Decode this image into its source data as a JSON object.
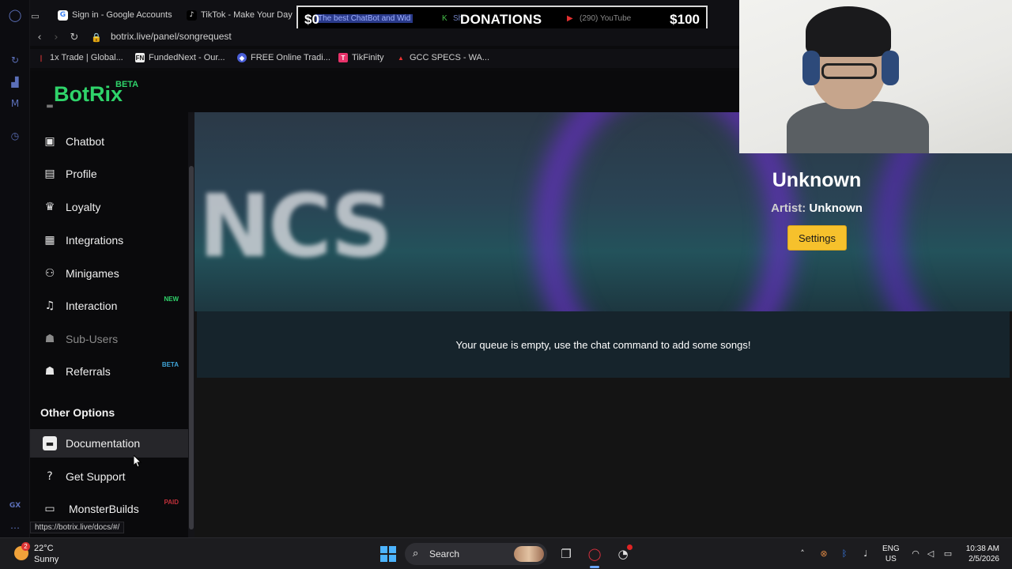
{
  "browser": {
    "tabs": [
      {
        "label": "Sign in - Google Accounts",
        "icon": "google-icon"
      },
      {
        "label": "TikTok - Make Your Day",
        "icon": "tiktok-icon"
      },
      {
        "label": "The best ChatBot and Wid",
        "icon": "botrix-icon"
      },
      {
        "label": "Sh",
        "icon": "kick-icon"
      },
      {
        "label": "(290) YouTube",
        "icon": "youtube-icon"
      }
    ],
    "url": "botrix.live/panel/songrequest",
    "bookmarks": [
      {
        "label": "1x Trade | Global...",
        "icon": "1x-icon"
      },
      {
        "label": "FundedNext - Our...",
        "icon": "fundednext-icon"
      },
      {
        "label": "FREE Online Tradi...",
        "icon": "trading-icon"
      },
      {
        "label": "TikFinity",
        "icon": "tikfinity-icon"
      },
      {
        "label": "GCC SPECS - WA...",
        "icon": "gcc-icon"
      }
    ],
    "link_hint": "https://botrix.live/docs/#/"
  },
  "donation_overlay": {
    "left_amount": "$0",
    "title": "DONATIONS",
    "right_amount": "$100"
  },
  "site": {
    "logo": "BotRix",
    "logo_badge": "BETA"
  },
  "sidebar": {
    "items": [
      {
        "label": "Chatbot",
        "icon": "robot-icon",
        "badge": ""
      },
      {
        "label": "Profile",
        "icon": "id-card-icon",
        "badge": ""
      },
      {
        "label": "Loyalty",
        "icon": "trophy-icon",
        "badge": ""
      },
      {
        "label": "Integrations",
        "icon": "integrations-icon",
        "badge": ""
      },
      {
        "label": "Minigames",
        "icon": "gamepad-icon",
        "badge": ""
      },
      {
        "label": "Interaction",
        "icon": "music-note-icon",
        "badge": "NEW"
      },
      {
        "label": "Sub-Users",
        "icon": "users-icon",
        "badge": ""
      },
      {
        "label": "Referrals",
        "icon": "user-group-icon",
        "badge": "BETA"
      }
    ],
    "other_title": "Other Options",
    "other_items": [
      {
        "label": "Documentation",
        "icon": "scroll-icon",
        "badge": ""
      },
      {
        "label": "Get Support",
        "icon": "question-circle-icon",
        "badge": ""
      },
      {
        "label": "MonsterBuilds",
        "icon": "laptop-icon",
        "badge": "PAID"
      }
    ]
  },
  "player": {
    "song_title": "Unknown",
    "artist_label": "Artist:",
    "artist_value": "Unknown",
    "settings_label": "Settings",
    "banner_text": "NCS",
    "queue_message": "Your queue is empty, use the chat command to add some songs!"
  },
  "taskbar": {
    "weather_temp": "22°C",
    "weather_desc": "Sunny",
    "weather_badge": "2",
    "search_label": "Search",
    "lang_top": "ENG",
    "lang_bottom": "US",
    "time": "10:38 AM",
    "date": "2/5/2026"
  },
  "colors": {
    "brand_green": "#2fd36a",
    "settings_yellow": "#f6c12c",
    "new_badge": "#2fd36a",
    "beta_badge": "#3fa4d8",
    "paid_badge": "#c0303a"
  }
}
